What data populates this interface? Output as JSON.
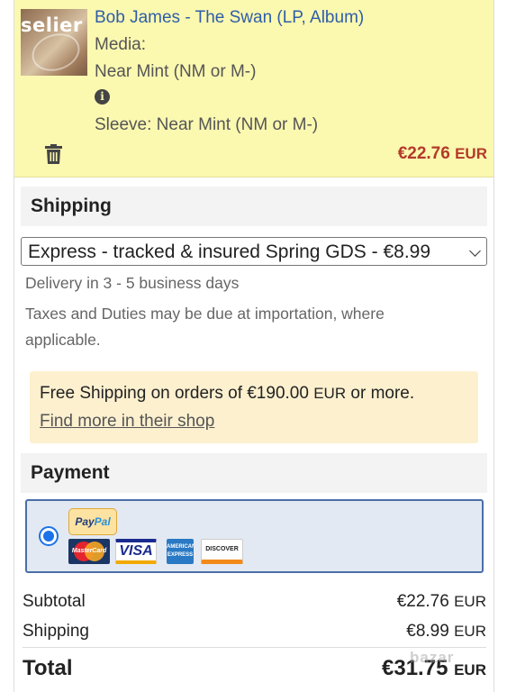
{
  "item": {
    "title": "Bob James - The Swan (LP, Album)",
    "thumb_text": "selier",
    "media_label": "Media:",
    "media_condition": "Near Mint (NM or M-)",
    "sleeve": "Sleeve: Near Mint (NM or M-)",
    "price": "€22.76",
    "price_currency": "EUR"
  },
  "shipping": {
    "heading": "Shipping",
    "selected_option": "Express - tracked & insured Spring GDS - €8.99",
    "delivery": "Delivery in 3 - 5 business days",
    "taxes_line1": "Taxes and Duties may be due at importation, where",
    "taxes_line2": "applicable.",
    "free_shipping_text": "Free Shipping on orders of €190.00",
    "free_shipping_currency": "EUR",
    "free_shipping_suffix": "or more.",
    "find_more_link": "Find more in their shop"
  },
  "payment": {
    "heading": "Payment",
    "paypal_label_a": "Pay",
    "paypal_label_b": "Pal",
    "visa_label": "VISA",
    "mastercard_label": "MasterCard",
    "amex_label": "AMERICAN EXPRESS",
    "discover_label": "DISCOVER",
    "selected": true
  },
  "summary": {
    "subtotal_label": "Subtotal",
    "subtotal_value": "€22.76",
    "subtotal_currency": "EUR",
    "shipping_label": "Shipping",
    "shipping_value": "€8.99",
    "shipping_currency": "EUR",
    "total_label": "Total",
    "total_value": "€31.75",
    "total_currency": "EUR"
  },
  "watermark": "bazar",
  "colors": {
    "item_bg": "#fbf8b0",
    "title_link": "#2f5ea8",
    "price_red": "#b33a2a",
    "notice_bg": "#fcf0cf",
    "payment_bg": "#e3e9f3",
    "payment_border": "#4a6fa8",
    "radio_blue": "#1a73e8"
  },
  "icons": {
    "info": "info-circle-icon",
    "delete": "trash-icon",
    "select": "chevron-down-icon"
  }
}
